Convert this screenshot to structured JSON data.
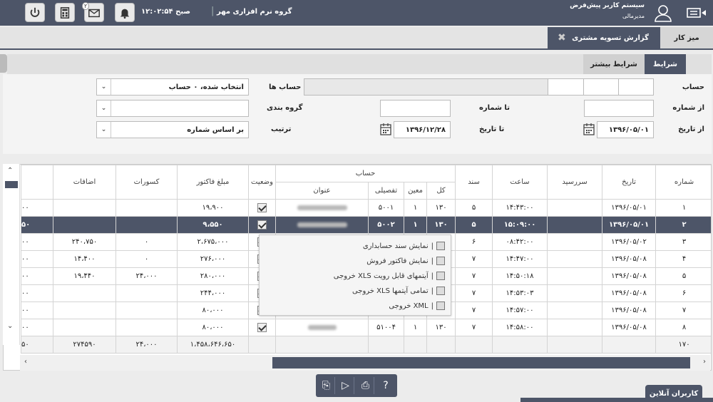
{
  "header": {
    "system_title": "سیستم کاربر پیش‌فرض",
    "user_role": "مدیرمالی",
    "company": "گروه نرم افزاری مهر",
    "time": "۱۲:۰۲:۵۴ صبح",
    "message_badge": "۲"
  },
  "tabs": {
    "desk": "میز کار",
    "report": "گزارش تسویه مشتری"
  },
  "subtabs": {
    "conditions": "شرایط",
    "more_conditions": "شرایط بیشتر"
  },
  "filters": {
    "account_label": "حساب",
    "accounts_label": "حساب ها",
    "accounts_value": "انتخاب شده، ۰ حساب",
    "from_number_label": "از شماره",
    "to_number_label": "تا شماره",
    "grouping_label": "گروه بندی",
    "from_date_label": "از تاریخ",
    "from_date_value": "۱۳۹۶/۰۵/۰۱",
    "to_date_label": "تا تاریخ",
    "to_date_value": "۱۳۹۶/۱۲/۲۸",
    "sort_label": "ترتیب",
    "sort_value": "بر اساس شماره"
  },
  "grid": {
    "headers": {
      "number": "شماره",
      "date": "تاریخ",
      "due": "سررسید",
      "time": "ساعت",
      "doc": "سند",
      "account": "حساب",
      "kol": "کل",
      "moein": "معین",
      "tafsili": "تفصیلی",
      "title": "عنوان",
      "status": "وضعیت",
      "invoice_amount": "مبلغ فاکتور",
      "deductions": "کسورات",
      "additions": "اضافات"
    },
    "rows": [
      {
        "num": "۱",
        "date": "۱۳۹۶/۰۵/۰۱",
        "due": "",
        "time": "۱۴:۴۳:۰۰",
        "doc": "۵",
        "kol": "۱۳۰",
        "moein": "۱",
        "tafsili": "۵۰۰۱",
        "amount": "۱۹،۹۰۰",
        "ded": "",
        "add": "",
        "edge": "۰۰"
      },
      {
        "num": "۲",
        "date": "۱۳۹۶/۰۵/۰۱",
        "due": "",
        "time": "۱۵:۰۹:۰۰",
        "doc": "۵",
        "kol": "۱۳۰",
        "moein": "۱",
        "tafsili": "۵۰۰۲",
        "amount": "۹،۵۵۰",
        "ded": "",
        "add": "",
        "edge": "۵۰"
      },
      {
        "num": "۳",
        "date": "۱۳۹۶/۰۵/۰۲",
        "due": "",
        "time": "۰۸:۴۲:۰۰",
        "doc": "۶",
        "kol": "",
        "moein": "",
        "tafsili": "",
        "amount": "۲،۶۷۵،۰۰۰",
        "ded": "۰",
        "add": "۲۴۰،۷۵۰",
        "edge": "۰۰"
      },
      {
        "num": "۴",
        "date": "۱۳۹۶/۰۵/۰۸",
        "due": "",
        "time": "۱۴:۴۷:۰۰",
        "doc": "۷",
        "kol": "",
        "moein": "",
        "tafsili": "",
        "amount": "۲۷۶،۰۰۰",
        "ded": "۰",
        "add": "۱۴،۴۰۰",
        "edge": "۰۰"
      },
      {
        "num": "۵",
        "date": "۱۳۹۶/۰۵/۰۸",
        "due": "",
        "time": "۱۴:۵۰:۱۸",
        "doc": "۷",
        "kol": "",
        "moein": "",
        "tafsili": "",
        "amount": "۲۸۰،۰۰۰",
        "ded": "۲۴،۰۰۰",
        "add": "۱۹،۴۴۰",
        "edge": "۰۰"
      },
      {
        "num": "۶",
        "date": "۱۳۹۶/۰۵/۰۸",
        "due": "",
        "time": "۱۴:۵۳:۰۳",
        "doc": "۷",
        "kol": "",
        "moein": "",
        "tafsili": "",
        "amount": "۲۴۴،۰۰۰",
        "ded": "",
        "add": "",
        "edge": "۰۰"
      },
      {
        "num": "۷",
        "date": "۱۳۹۶/۰۵/۰۸",
        "due": "",
        "time": "۱۴:۵۷:۰۰",
        "doc": "۷",
        "kol": "",
        "moein": "",
        "tafsili": "",
        "amount": "۸۰،۰۰۰",
        "ded": "",
        "add": "",
        "edge": "۰۰"
      },
      {
        "num": "۸",
        "date": "۱۳۹۶/۰۵/۰۸",
        "due": "",
        "time": "۱۴:۵۸:۰۰",
        "doc": "۷",
        "kol": "۱۳۰",
        "moein": "۱",
        "tafsili": "۵۱۰۰۴",
        "amount": "۸۰،۰۰۰",
        "ded": "",
        "add": "",
        "edge": "۰۰"
      }
    ],
    "footer": {
      "count": "۱۷۰",
      "amount": "۱،۴۵۸،۶۴۶،۶۵۰",
      "ded": "۲۴،۰۰۰",
      "add": "۲۷۴۵۹۰",
      "edge": "۵۰"
    }
  },
  "context_menu": [
    "نمایش سند حسابداری",
    "نمایش فاکتور فروش",
    "خروجی XLS آیتمهای قابل رویت",
    "خروجی XLS تمامی آیتمها",
    "خروجی XML"
  ],
  "online_users": "کاربران آنلاین",
  "colors": {
    "primary": "#4d5568",
    "background": "#ececec"
  }
}
